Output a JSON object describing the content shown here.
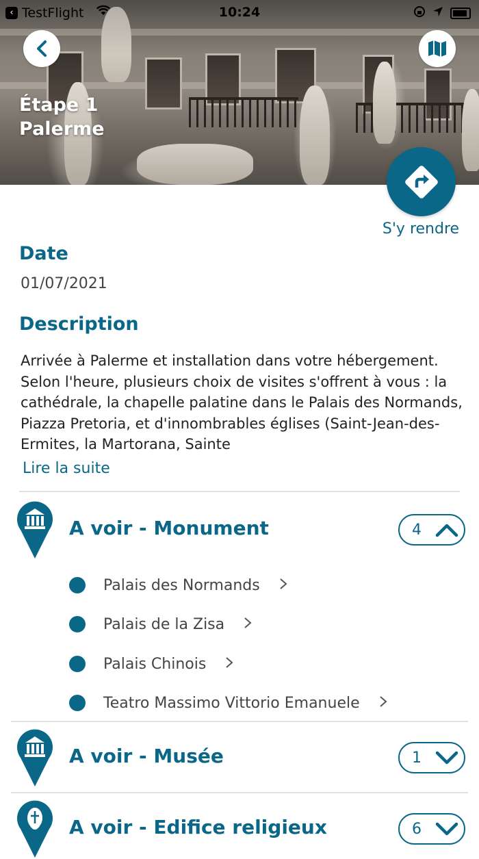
{
  "status_bar": {
    "back_app": "TestFlight",
    "time": "10:24"
  },
  "hero": {
    "stage": "Étape 1",
    "city": "Palerme"
  },
  "directions": {
    "label": "S'y rendre"
  },
  "date": {
    "title": "Date",
    "value": "01/07/2021"
  },
  "description": {
    "title": "Description",
    "text": "Arrivée à Palerme et installation dans votre hébergement. Selon l'heure, plusieurs choix de visites s'offrent à vous : la cathédrale, la chapelle palatine dans le Palais des Normands, Piazza Pretoria, et d'innombrables églises (Saint-Jean-des-Ermites, la Martorana, Sainte",
    "read_more": "Lire la suite"
  },
  "categories": [
    {
      "title": "A voir - Monument",
      "count": "4",
      "expanded": true,
      "icon": "monument-pin-icon",
      "items": [
        "Palais des Normands",
        "Palais de la Zisa",
        "Palais Chinois",
        "Teatro Massimo Vittorio Emanuele"
      ]
    },
    {
      "title": "A voir - Musée",
      "count": "1",
      "expanded": false,
      "icon": "museum-pin-icon"
    },
    {
      "title": "A voir - Edifice religieux",
      "count": "6",
      "expanded": false,
      "icon": "religious-building-pin-icon"
    }
  ],
  "colors": {
    "accent": "#0a6788"
  }
}
